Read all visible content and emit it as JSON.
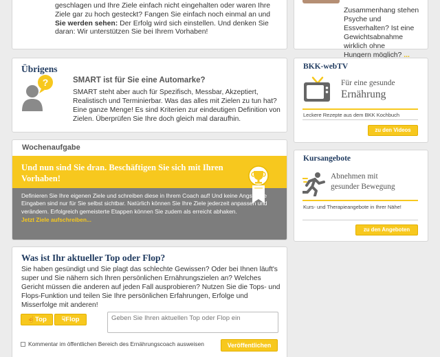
{
  "colors": {
    "accent": "#f7c81e",
    "title": "#1f3a5f",
    "gray_band": "#7d7d7d"
  },
  "top_box": {
    "line1": "geschlagen und Ihre Ziele einfach nicht eingehalten oder waren Ihre",
    "line2": "Ziele gar zu hoch gesteckt? Fangen Sie einfach noch einmal an und",
    "line3_bold": "Sie werden sehen:",
    "line3_rest": " Der Erfolg wird sich einstellen. Und denken Sie",
    "line4": "daran: Wir unterstützen Sie bei Ihrem Vorhaben!"
  },
  "top_right_box": {
    "line1": "Zusammenhang stehen",
    "line2": "Psyche und",
    "line3": "Essverhalten? Ist eine",
    "line4": "Gewichtsabnahme wirklich ohne",
    "line5": "Hungern möglich?",
    "more_link": "... mehr"
  },
  "uebrigens": {
    "title": "Übrigens",
    "icon": "person-question-icon",
    "heading": "SMART ist für Sie eine Automarke?",
    "body": "SMART steht aber auch für Spezifisch, Messbar, Akzeptiert, Realistisch und Terminierbar. Was das alles mit Zielen zu tun hat? Eine ganze Menge! Es sind Kriterien zur eindeutigen Definition von Zielen. Überprüfen Sie Ihre doch gleich mal daraufhin."
  },
  "wochenaufgabe": {
    "header": "Wochenaufgabe",
    "banner": "Und nun sind Sie dran. Beschäftigen Sie sich mit Ihren Vorhaben!",
    "body": "Definieren Sie Ihre eigenen Ziele und schreiben diese in Ihrem Coach auf! Und keine Angst: Ihre Eingaben sind nur für Sie selbst sichtbar. Natürlich können Sie Ihre Ziele jederzeit anpassen und verändern. Erfolgreich gemeisterte Etappen können Sie zudem als erreicht abhaken.",
    "link": "Jetzt Ziele aufschreiben...",
    "icon": "trophy-icon"
  },
  "top_flop": {
    "title": "Was ist Ihr aktueller Top oder Flop?",
    "body": "Sie haben gesündigt und Sie plagt das schlechte Gewissen? Oder bei Ihnen läuft's super und Sie nähern sich Ihren persönlichen Ernährungszielen an? Welches Gericht müssen die anderen auf jeden Fall ausprobieren? Nutzen Sie die Tops- und Flops-Funktion und teilen Sie Ihre persönlichen Erfahrungen, Erfolge und Misserfolge mit anderen!",
    "top_label": "Top",
    "flop_label": "Flop",
    "input_placeholder": "Geben Sie Ihren aktuellen Top oder Flop ein",
    "checkbox_label": "Kommentar im öffentlichen Bereich des Ernährungscoach ausweisen",
    "publish_label": "Veröffentlichen"
  },
  "webtv": {
    "title": "BKK-webTV",
    "icon": "tv-icon",
    "line1": "Für eine gesunde",
    "line2": "Ernährung",
    "caption": "Leckere Rezepte aus dem BKK Kochbuch",
    "button": "zu den Videos"
  },
  "kurs": {
    "title": "Kursangebote",
    "icon": "runner-icon",
    "line1": "Abnehmen mit",
    "line2": "gesunder Bewegung",
    "caption": "Kurs- und Therapieangebote in Ihrer Nähe!",
    "button": "zu den Angeboten"
  }
}
